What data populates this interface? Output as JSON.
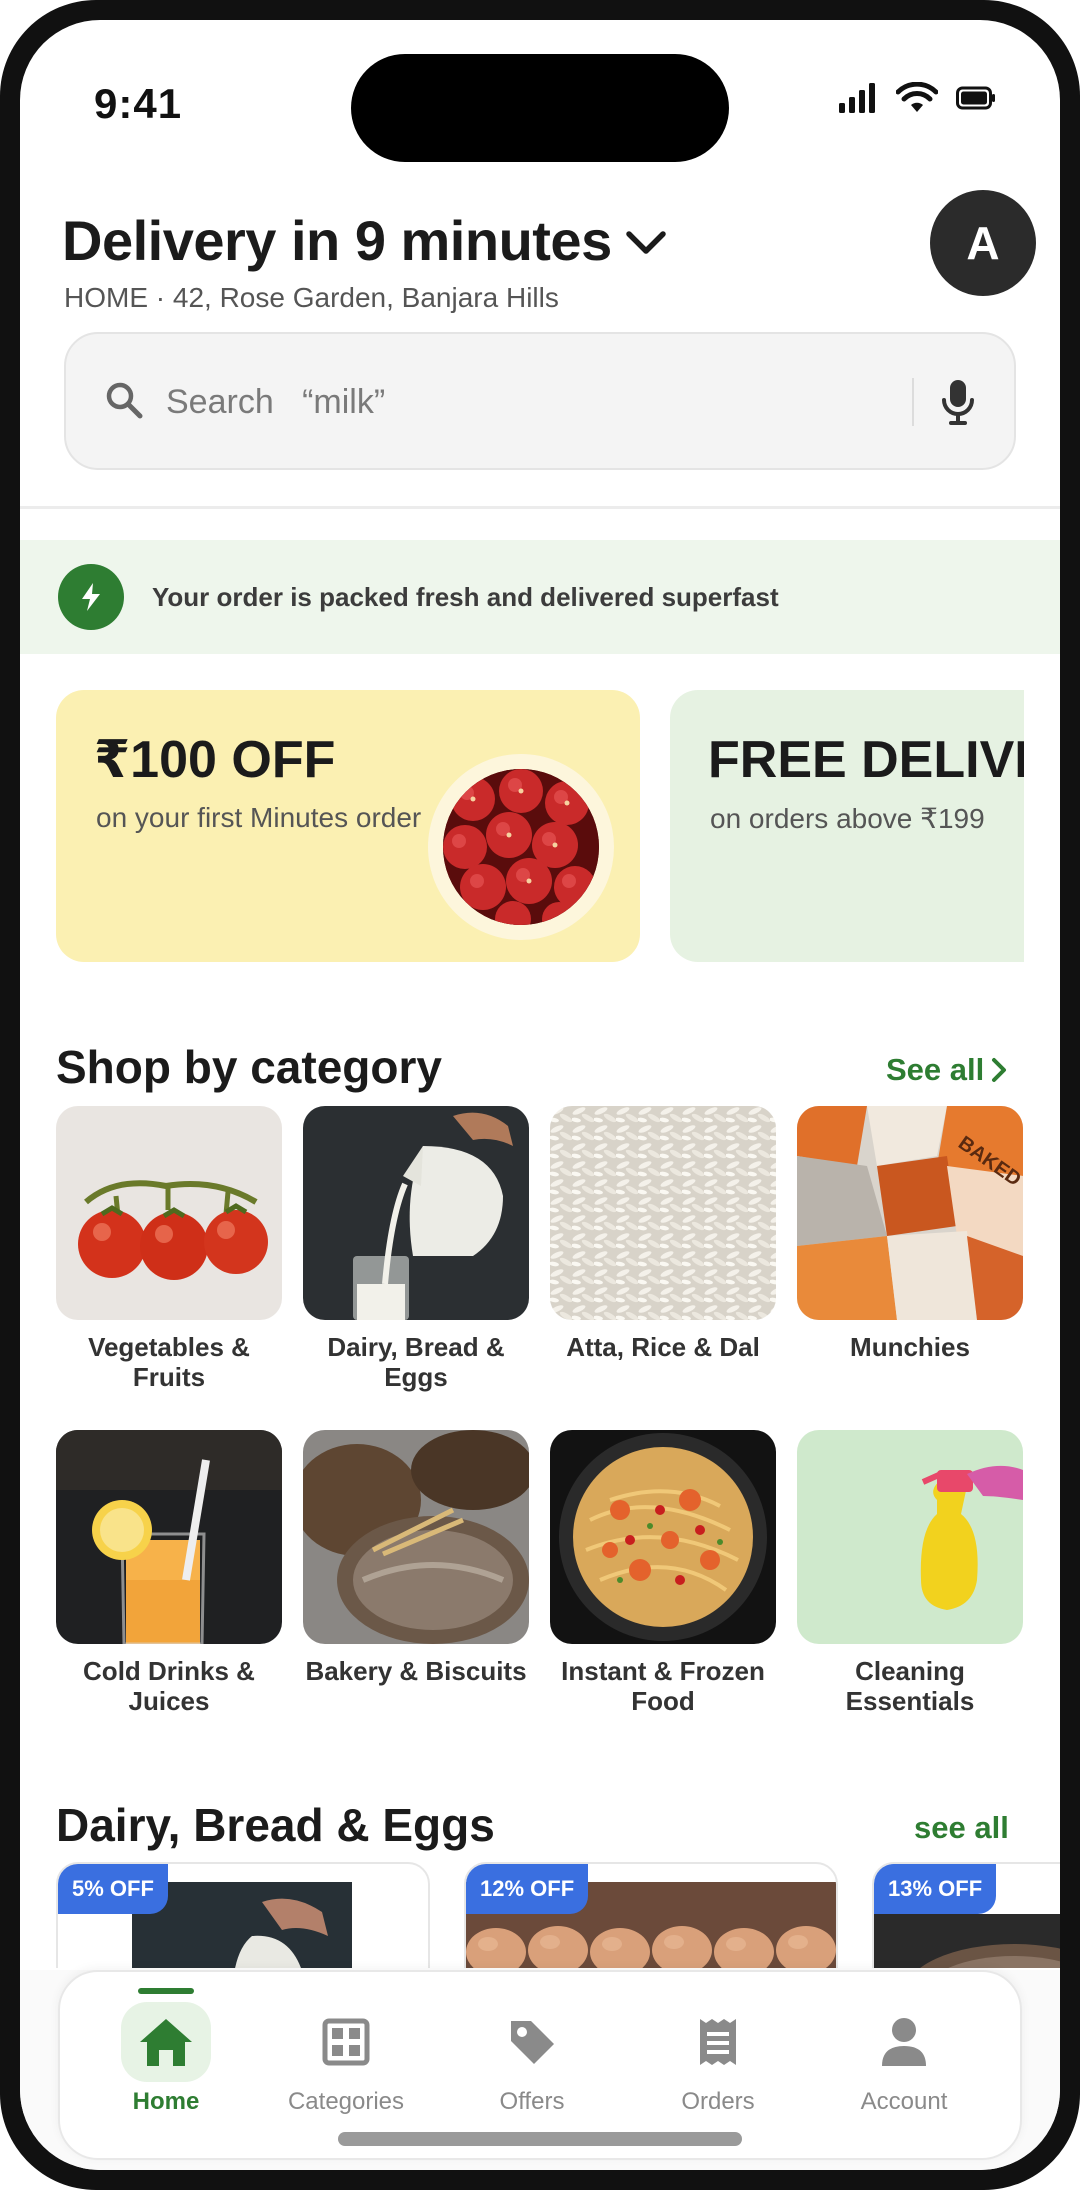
{
  "status_bar": {
    "time": "9:41"
  },
  "header": {
    "delivery_title": "Delivery in 9 minutes",
    "address": "HOME · 42, Rose Garden, Banjara Hills",
    "avatar_initial": "A"
  },
  "search": {
    "placeholder": "Search   “milk”"
  },
  "info_banner": {
    "text": "Your order is packed fresh and delivered superfast"
  },
  "promos": [
    {
      "title": "₹100 OFF",
      "subtitle": "on your first Minutes order"
    },
    {
      "title": "FREE DELIVERY",
      "subtitle": "on orders above ₹199"
    }
  ],
  "shop_by_category": {
    "title": "Shop by category",
    "see_all": "See all",
    "items": [
      {
        "label": "Vegetables & Fruits"
      },
      {
        "label": "Dairy, Bread & Eggs"
      },
      {
        "label": "Atta, Rice & Dal"
      },
      {
        "label": "Munchies"
      },
      {
        "label": "Cold Drinks & Juices"
      },
      {
        "label": "Bakery & Biscuits"
      },
      {
        "label": "Instant & Frozen Food"
      },
      {
        "label": "Cleaning Essentials"
      }
    ]
  },
  "dairy_section": {
    "title": "Dairy, Bread & Eggs",
    "see_all": "see all",
    "products": [
      {
        "badge": "5% OFF"
      },
      {
        "badge": "12% OFF"
      },
      {
        "badge": "13% OFF"
      }
    ]
  },
  "bottom_nav": {
    "items": [
      {
        "label": "Home",
        "icon": "home-icon",
        "active": true
      },
      {
        "label": "Categories",
        "icon": "grid-icon",
        "active": false
      },
      {
        "label": "Offers",
        "icon": "tag-icon",
        "active": false
      },
      {
        "label": "Orders",
        "icon": "receipt-icon",
        "active": false
      },
      {
        "label": "Account",
        "icon": "person-icon",
        "active": false
      }
    ]
  },
  "colors": {
    "brand_green": "#2e7d32",
    "badge_blue": "#3a6fe0",
    "promo_yellow": "#fbf0b2",
    "promo_green": "#e6f2e2"
  }
}
